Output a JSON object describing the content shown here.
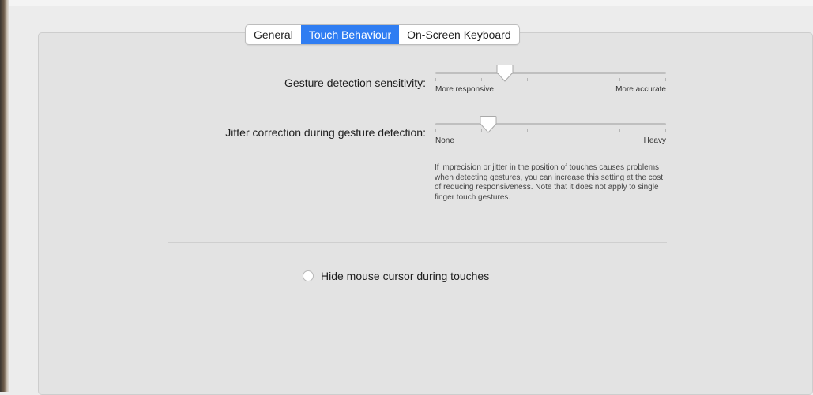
{
  "tabs": [
    {
      "label": "General",
      "active": false
    },
    {
      "label": "Touch Behaviour",
      "active": true
    },
    {
      "label": "On-Screen Keyboard",
      "active": false
    }
  ],
  "gesture_sensitivity": {
    "label": "Gesture detection sensitivity:",
    "min_label": "More responsive",
    "max_label": "More accurate",
    "value": 0.3,
    "tick_count": 6
  },
  "jitter_correction": {
    "label": "Jitter correction during gesture detection:",
    "min_label": "None",
    "max_label": "Heavy",
    "value": 0.23,
    "tick_count": 6,
    "help_text": "If imprecision or jitter in the position of touches causes problems when detecting gestures, you can increase this setting at the cost of reducing responsiveness. Note that it does not apply to single finger touch gestures."
  },
  "hide_cursor": {
    "label": "Hide mouse cursor during touches",
    "checked": false
  },
  "colors": {
    "accent": "#2f7df2",
    "panel": "#e3e3e3",
    "background": "#ececec"
  }
}
